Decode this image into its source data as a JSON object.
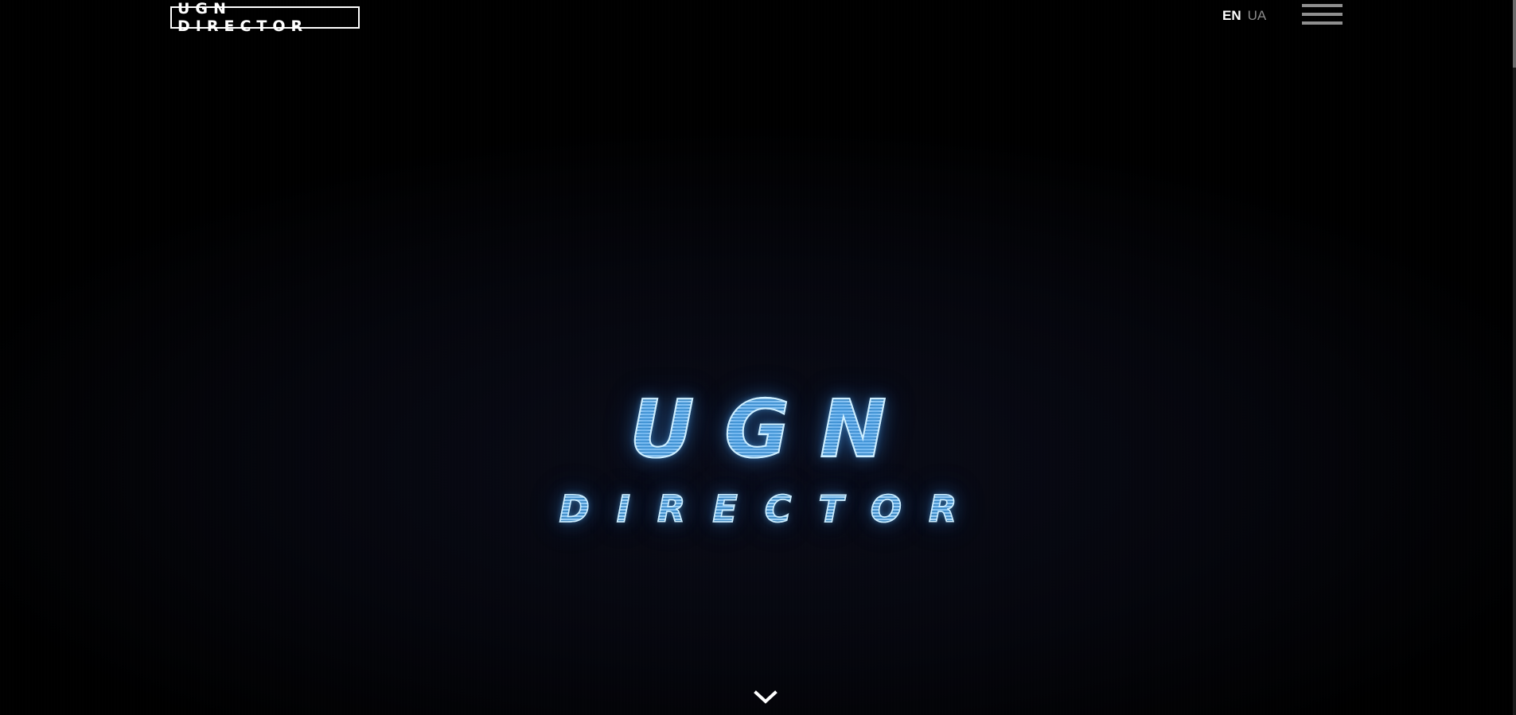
{
  "header": {
    "logo_text": "UGN DIRECTOR",
    "languages": {
      "active": "EN",
      "inactive": "UA"
    },
    "menu_icon": "hamburger-menu-icon"
  },
  "hero": {
    "title": "UGN",
    "subtitle": "DIRECTOR",
    "glow_color": "#5aaee8"
  },
  "scroll_icon": "chevron-down-icon",
  "colors": {
    "background": "#000000",
    "text": "#ffffff",
    "muted": "#8a8a8a"
  }
}
